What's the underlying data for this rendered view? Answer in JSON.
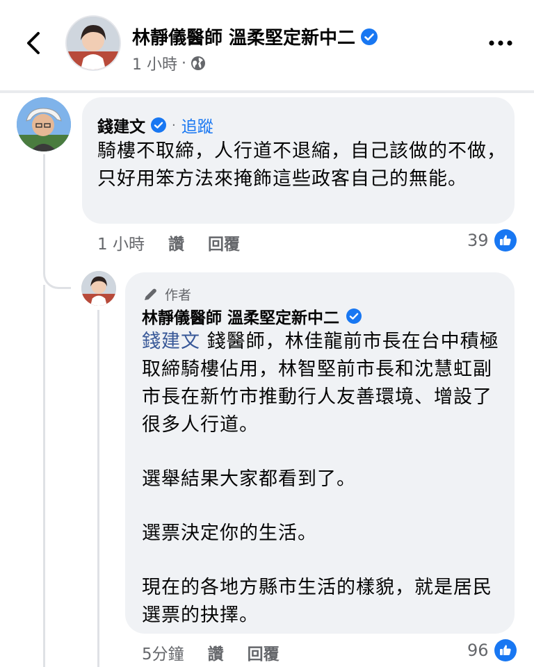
{
  "header": {
    "page_name": "林靜儀醫師 溫柔堅定新中二",
    "time": "1 小時",
    "meta_sep": "·"
  },
  "comment": {
    "author": "錢建文",
    "sep": "·",
    "follow_label": "追蹤",
    "text": "騎樓不取締，人行道不退縮，自己該做的不做，只好用笨方法來掩飾這些政客自己的無能。",
    "time": "1 小時",
    "like_label": "讚",
    "reply_label": "回覆",
    "like_count": "39"
  },
  "reply": {
    "author_tag": "作者",
    "author": "林靜儀醫師 溫柔堅定新中二",
    "mention": "錢建文",
    "para1": "錢醫師，林佳龍前市長在台中積極取締騎樓佔用，林智堅前市長和沈慧虹副市長在新竹市推動行人友善環境、增設了很多人行道。",
    "para2": "選舉結果大家都看到了。",
    "para3": "選票決定你的生活。",
    "para4": "現在的各地方縣市生活的樣貌，就是居民選票的抉擇。",
    "time": "5分鐘",
    "like_label": "讚",
    "reply_label": "回覆",
    "like_count": "96"
  },
  "icons": {
    "back": "chevron-left-icon",
    "more": "more-dots-icon",
    "globe": "globe-icon",
    "verified": "verified-badge-icon",
    "like": "thumbs-up-icon",
    "author": "pencil-icon"
  },
  "colors": {
    "accent": "#1877f2",
    "bubble": "#f0f2f5",
    "muted": "#65676b"
  }
}
